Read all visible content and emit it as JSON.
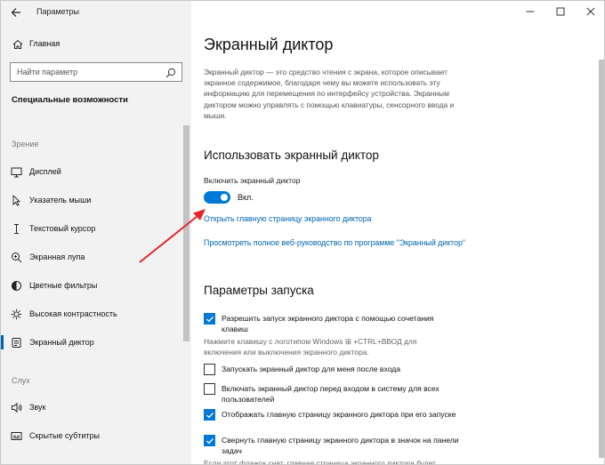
{
  "window": {
    "title": "Параметры"
  },
  "sidebar": {
    "home_label": "Главная",
    "search_placeholder": "Найти параметр",
    "section_title": "Специальные возможности",
    "group_vision": "Зрение",
    "group_hearing": "Слух",
    "items": [
      {
        "label": "Дисплей",
        "icon": "display-icon"
      },
      {
        "label": "Указатель мыши",
        "icon": "mouse-pointer-icon"
      },
      {
        "label": "Текстовый курсор",
        "icon": "text-cursor-icon"
      },
      {
        "label": "Экранная лупа",
        "icon": "magnifier-icon"
      },
      {
        "label": "Цветные фильтры",
        "icon": "color-filter-icon"
      },
      {
        "label": "Высокая контрастность",
        "icon": "contrast-icon"
      },
      {
        "label": "Экранный диктор",
        "icon": "narrator-icon",
        "active": true
      },
      {
        "label": "Звук",
        "icon": "speaker-icon"
      },
      {
        "label": "Скрытые субтитры",
        "icon": "captions-icon"
      }
    ]
  },
  "main": {
    "title": "Экранный диктор",
    "description": "Экранный диктор — это средство чтения с экрана, которое описывает экранное содержимое, благодаря чему вы можете использовать эту информацию для перемещения по интерфейсу устройства. Экранным диктором можно управлять с помощью клавиатуры, сенсорного ввода и мыши.",
    "use_heading": "Использовать экранный диктор",
    "toggle_label": "Включить экранный диктор",
    "toggle_state": "Вкл.",
    "toggle_on": true,
    "link_home": "Открыть главную страницу экранного диктора",
    "link_guide": "Просмотреть полное веб-руководство по программе \"Экранный диктор\"",
    "startup_heading": "Параметры запуска",
    "options": [
      {
        "label": "Разрешить запуск экранного диктора с помощью сочетания клавиш",
        "checked": true
      },
      {
        "label": "Запускать экранный диктор для меня после входа",
        "checked": false
      },
      {
        "label": "Включать экранный диктор перед входом в систему для всех пользователей",
        "checked": false
      },
      {
        "label": "Отображать главную страницу экранного диктора при его запуске",
        "checked": true
      },
      {
        "label": "Свернуть главную страницу экранного диктора в значок на панели задач",
        "checked": true
      }
    ],
    "shortcut_hint": "Нажмите клавишу с логотипом Windows ⊞ +CTRL+ВВОД для включения или выключения экранного диктора.",
    "bottom_hint": "Если этот флажок снят, главная страница экранного диктора будет"
  },
  "colors": {
    "accent": "#0078d7",
    "link": "#0066b4",
    "arrow": "#e3262d"
  }
}
